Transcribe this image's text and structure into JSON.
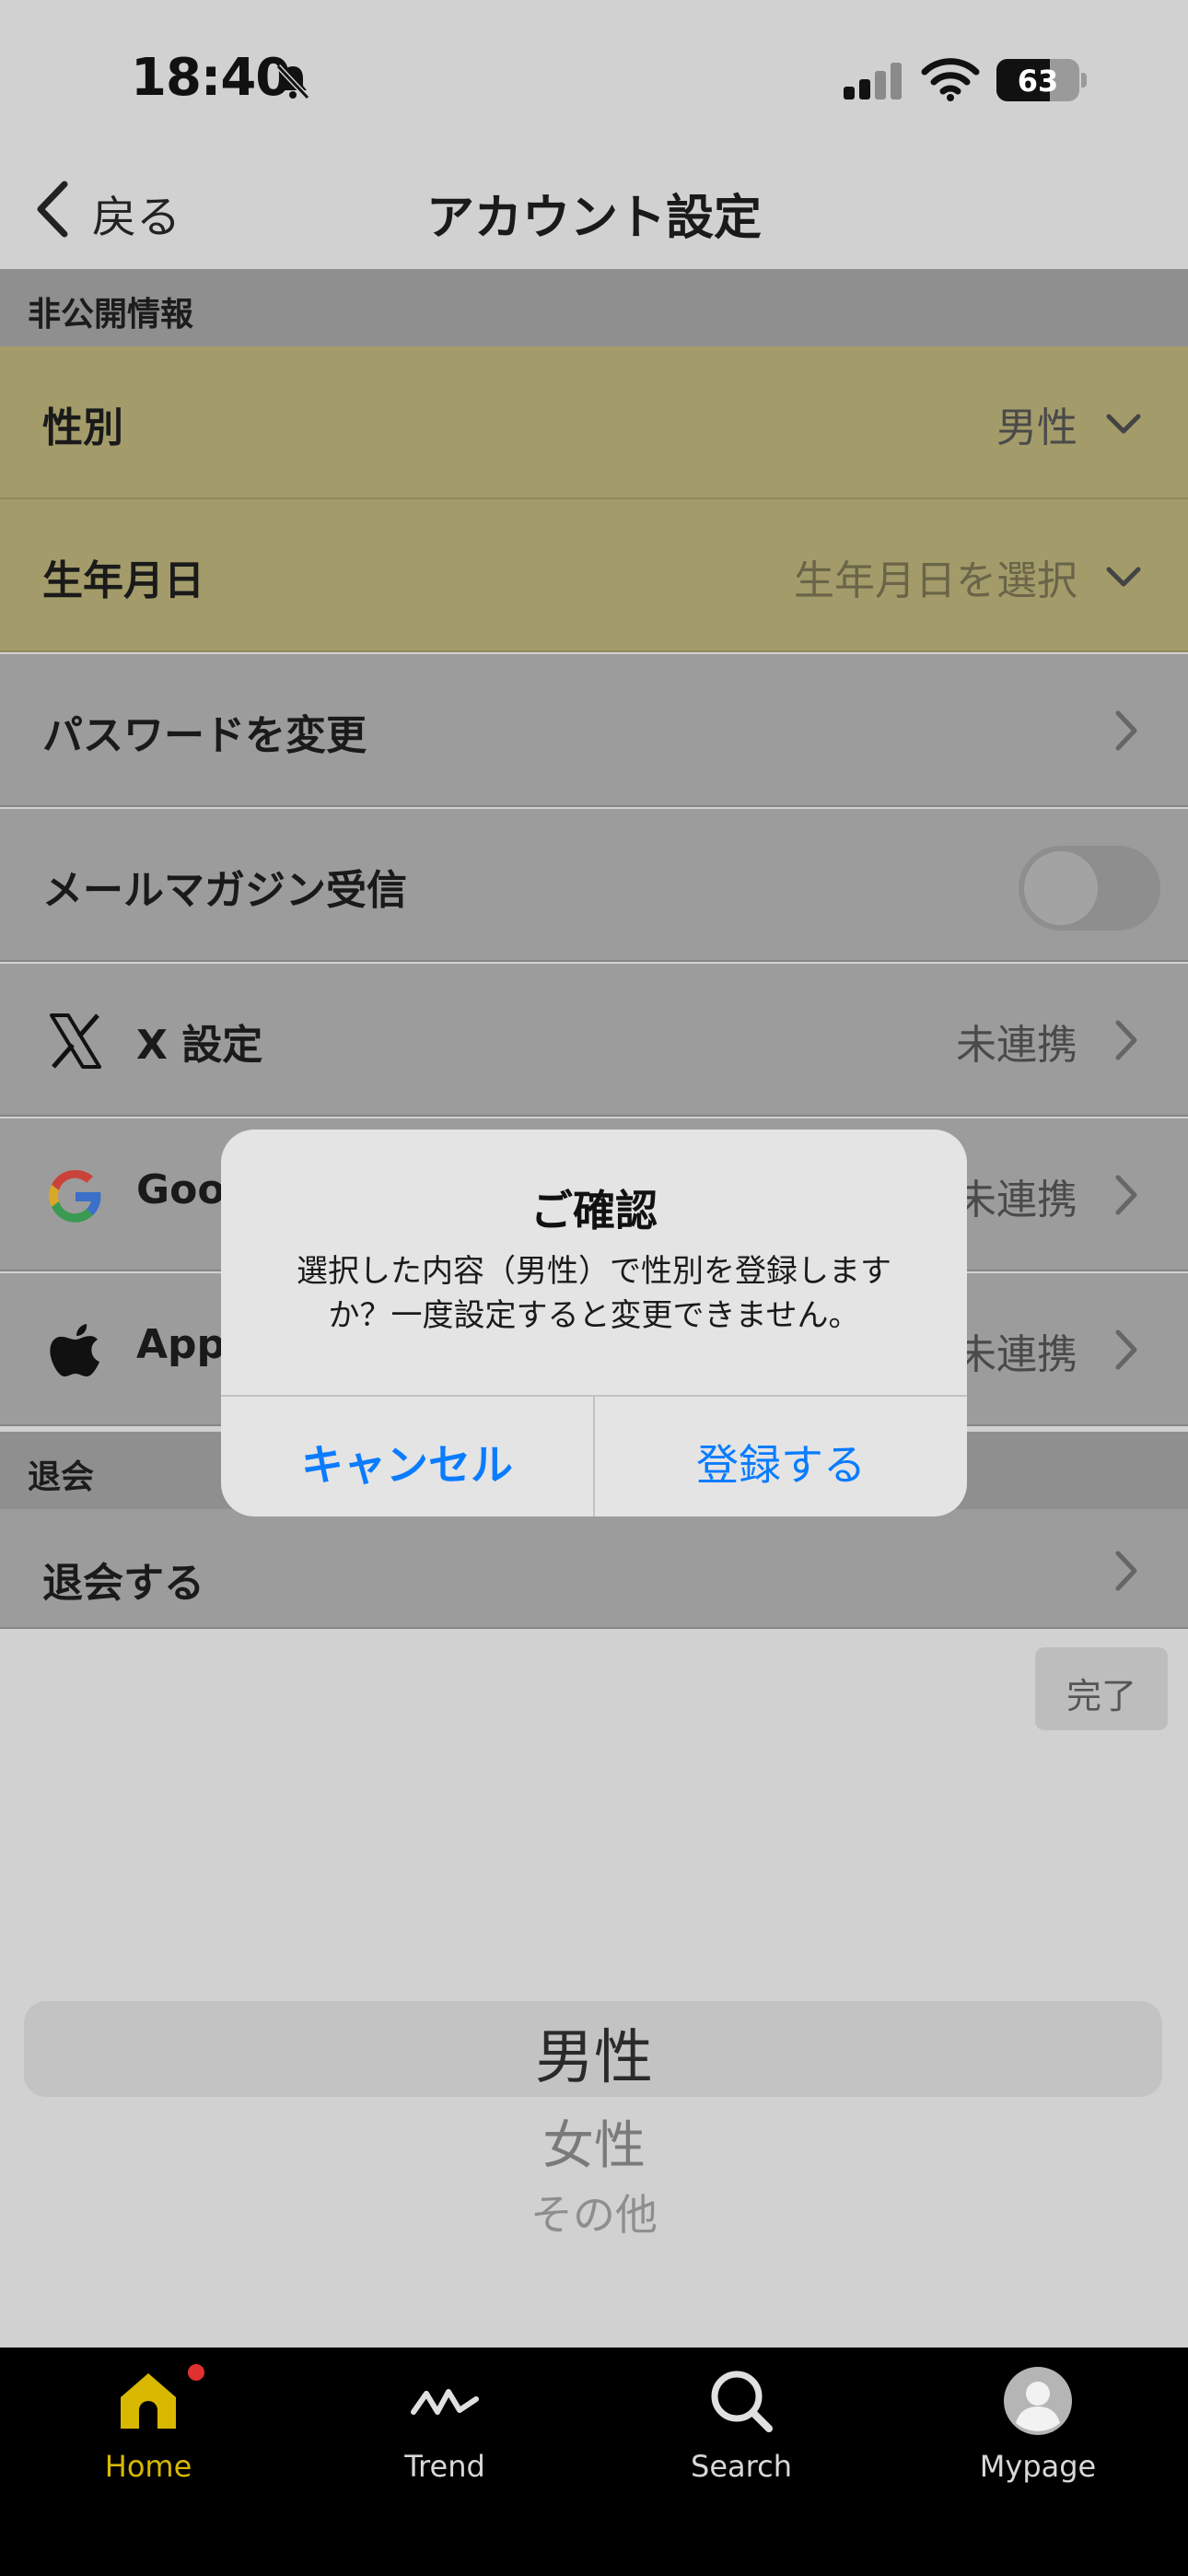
{
  "status_bar": {
    "time": "18:40",
    "battery": "63",
    "icons": [
      "bell-slash-icon",
      "cellular-signal-icon",
      "wifi-icon",
      "battery-icon"
    ]
  },
  "nav": {
    "back_label": "戻る",
    "title": "アカウント設定"
  },
  "sections": [
    {
      "header": "非公開情報"
    },
    {
      "header": "退会"
    }
  ],
  "rows": {
    "gender": {
      "label": "性別",
      "value": "男性"
    },
    "birthday": {
      "label": "生年月日",
      "value": "生年月日を選択"
    },
    "password": {
      "label": "パスワードを変更"
    },
    "newsletter": {
      "label": "メールマガジン受信",
      "enabled": false
    },
    "x": {
      "label": "X 設定",
      "value": "未連携"
    },
    "google": {
      "label": "Goog",
      "value": "未連携"
    },
    "apple": {
      "label": "Appl",
      "value": "未連携"
    },
    "withdraw": {
      "label": "退会する"
    }
  },
  "picker": {
    "done_label": "完了",
    "options": [
      "男性",
      "女性",
      "その他"
    ],
    "selected": "男性"
  },
  "dialog": {
    "title": "ご確認",
    "message": "選択した内容（男性）で性別を登録しますか？一度設定すると変更できません。",
    "cancel_label": "キャンセル",
    "confirm_label": "登録する"
  },
  "tabbar": {
    "tabs": [
      {
        "label": "Home",
        "icon": "home-icon",
        "active": true,
        "badge": true
      },
      {
        "label": "Trend",
        "icon": "trend-icon",
        "active": false
      },
      {
        "label": "Search",
        "icon": "search-icon",
        "active": false
      },
      {
        "label": "Mypage",
        "icon": "user-avatar-icon",
        "active": false
      }
    ]
  },
  "colors": {
    "accent": "#0a7cff",
    "brand_yellow": "#d8b800",
    "highlight_row": "#a39c6a",
    "overlay": "#9c9c9c"
  }
}
